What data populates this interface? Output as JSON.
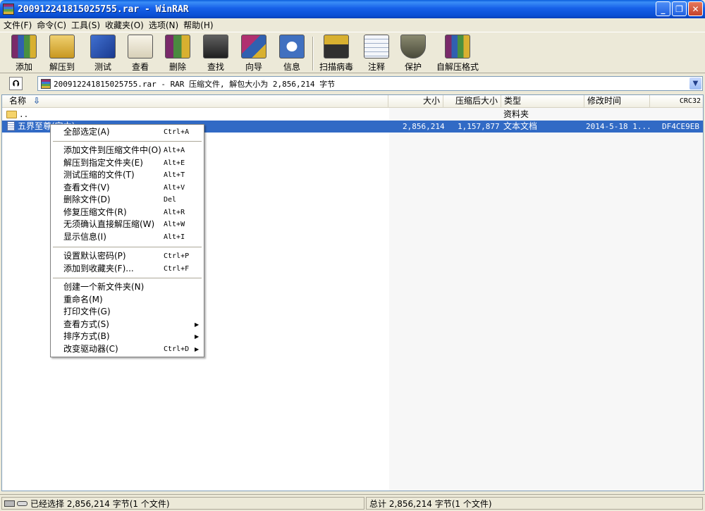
{
  "window": {
    "title": "200912241815025755.rar - WinRAR",
    "minimize_glyph": "_",
    "maximize_glyph": "❐",
    "close_glyph": "✕"
  },
  "menubar": {
    "items": [
      "文件(F)",
      "命令(C)",
      "工具(S)",
      "收藏夹(O)",
      "选项(N)",
      "帮助(H)"
    ]
  },
  "toolbar": {
    "buttons": [
      {
        "label": "添加",
        "icon": "add-books-icon",
        "color": "#7a2a6a"
      },
      {
        "label": "解压到",
        "icon": "extract-folder-icon",
        "color": "#d8b030"
      },
      {
        "label": "测试",
        "icon": "test-check-icon",
        "color": "#2050b0"
      },
      {
        "label": "查看",
        "icon": "view-glasses-icon",
        "color": "#e8e0c8"
      },
      {
        "label": "删除",
        "icon": "delete-recycle-icon",
        "color": "#4a8a40"
      },
      {
        "label": "查找",
        "icon": "find-binoculars-icon",
        "color": "#303030"
      },
      {
        "label": "向导",
        "icon": "wizard-icon",
        "color": "#b03070"
      },
      {
        "label": "信息",
        "icon": "info-icon",
        "color": "#4070c0"
      },
      {
        "label": "扫描病毒",
        "icon": "virus-scan-icon",
        "color": "#303030"
      },
      {
        "label": "注释",
        "icon": "comment-pen-icon",
        "color": "#e0e8f0"
      },
      {
        "label": "保护",
        "icon": "protect-shield-icon",
        "color": "#707060"
      },
      {
        "label": "自解压格式",
        "icon": "sfx-archive-icon",
        "color": "#5a9040"
      }
    ]
  },
  "addressbar": {
    "up_glyph": "⮉",
    "path": "200912241815025755.rar - RAR 压缩文件, 解包大小为 2,856,214 字节",
    "dropdown_glyph": "▼"
  },
  "list": {
    "columns": {
      "name": "名称",
      "sort_glyph": "⇩",
      "size": "大小",
      "packed": "压缩后大小",
      "type": "类型",
      "modified": "修改时间",
      "crc": "CRC32"
    },
    "rows": [
      {
        "name": "..",
        "size": "",
        "packed": "",
        "type": "资料夹",
        "modified": "",
        "crc": "",
        "kind": "folder"
      },
      {
        "name": "五界至尊(完本)",
        "size": "2,856,214",
        "packed": "1,157,877",
        "type": "文本文档",
        "modified": "2014-5-18 1...",
        "crc": "DF4CE9EB",
        "kind": "file"
      }
    ]
  },
  "context_menu": {
    "groups": [
      [
        {
          "label": "全部选定(A)",
          "shortcut": "Ctrl+A"
        }
      ],
      [
        {
          "label": "添加文件到压缩文件中(O)",
          "shortcut": "Alt+A"
        },
        {
          "label": "解压到指定文件夹(E)",
          "shortcut": "Alt+E"
        },
        {
          "label": "测试压缩的文件(T)",
          "shortcut": "Alt+T"
        },
        {
          "label": "查看文件(V)",
          "shortcut": "Alt+V"
        },
        {
          "label": "删除文件(D)",
          "shortcut": "Del"
        },
        {
          "label": "修复压缩文件(R)",
          "shortcut": "Alt+R"
        },
        {
          "label": "无须确认直接解压缩(W)",
          "shortcut": "Alt+W"
        },
        {
          "label": "显示信息(I)",
          "shortcut": "Alt+I"
        }
      ],
      [
        {
          "label": "设置默认密码(P)",
          "shortcut": "Ctrl+P"
        },
        {
          "label": "添加到收藏夹(F)...",
          "shortcut": "Ctrl+F"
        }
      ],
      [
        {
          "label": "创建一个新文件夹(N)",
          "shortcut": ""
        },
        {
          "label": "重命名(M)",
          "shortcut": ""
        },
        {
          "label": "打印文件(G)",
          "shortcut": ""
        },
        {
          "label": "查看方式(S)",
          "shortcut": "",
          "submenu": true
        },
        {
          "label": "排序方式(B)",
          "shortcut": "",
          "submenu": true
        },
        {
          "label": "改变驱动器(C)",
          "shortcut": "Ctrl+D",
          "submenu": true
        }
      ]
    ],
    "submenu_glyph": "▶"
  },
  "statusbar": {
    "left": "已经选择 2,856,214 字节(1 个文件)",
    "right": "总计 2,856,214 字节(1 个文件)"
  }
}
